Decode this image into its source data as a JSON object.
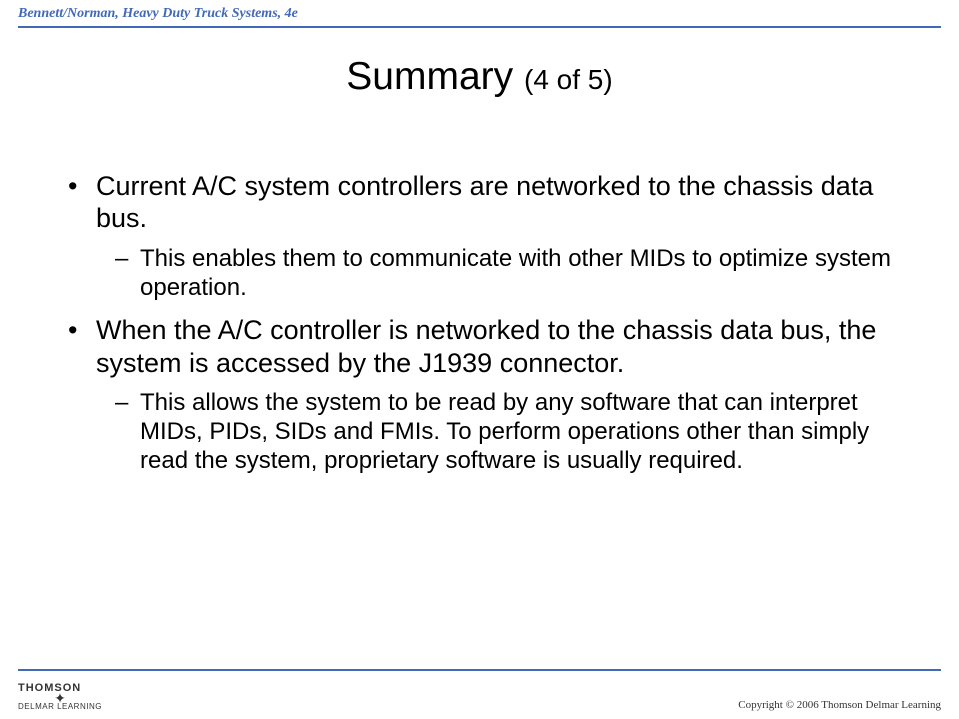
{
  "header": {
    "text": "Bennett/Norman, Heavy Duty Truck Systems, 4e"
  },
  "title": {
    "main": "Summary ",
    "sub": "(4 of 5)"
  },
  "bullets": {
    "b1": "Current A/C system controllers are networked to the chassis data bus.",
    "b1_sub": "This enables them to communicate with other MIDs to optimize system operation.",
    "b2": "When the A/C controller is networked to the chassis data bus, the system is accessed by the J1939 connector.",
    "b2_sub": "This allows the system to be read by any software that can interpret MIDs, PIDs, SIDs and FMIs. To perform operations other than simply read the system, proprietary software is usually required."
  },
  "footer": {
    "logo_thomson": "THOMSON",
    "logo_delmar": "DELMAR LEARNING",
    "copyright": "Copyright © 2006 Thomson Delmar Learning"
  }
}
